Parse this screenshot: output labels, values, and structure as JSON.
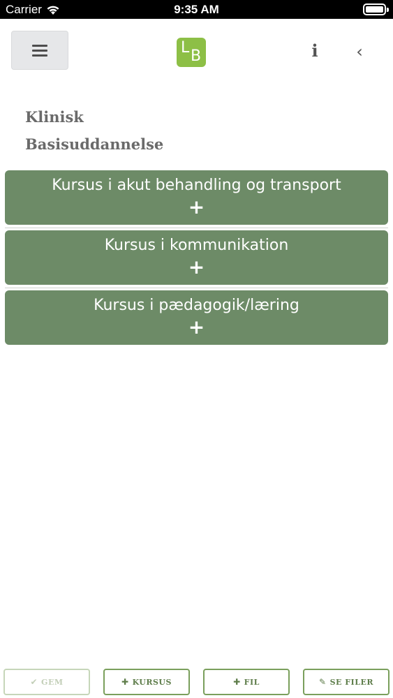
{
  "status_bar": {
    "carrier": "Carrier",
    "time": "9:35 AM"
  },
  "header": {
    "logo_left": "L",
    "logo_right": "B",
    "info_glyph": "i",
    "back_glyph": "‹"
  },
  "title": {
    "line1": "Klinisk",
    "line2": "Basisuddannelse"
  },
  "courses": [
    {
      "label": "Kursus i akut behandling og transport",
      "icon": "+"
    },
    {
      "label": "Kursus i kommunikation",
      "icon": "+"
    },
    {
      "label": "Kursus i pædagogik/læring",
      "icon": "+"
    }
  ],
  "toolbar": {
    "save": {
      "icon": "✔",
      "label": "GEM"
    },
    "add_course": {
      "icon": "✚",
      "label": "KURSUS"
    },
    "add_file": {
      "icon": "✚",
      "label": "FIL"
    },
    "view_files": {
      "icon": "✎",
      "label": "SE FILER"
    }
  },
  "colors": {
    "accent": "#6d8b67",
    "logo": "#8dbf46",
    "toolbar_border": "#7a9f5c"
  }
}
